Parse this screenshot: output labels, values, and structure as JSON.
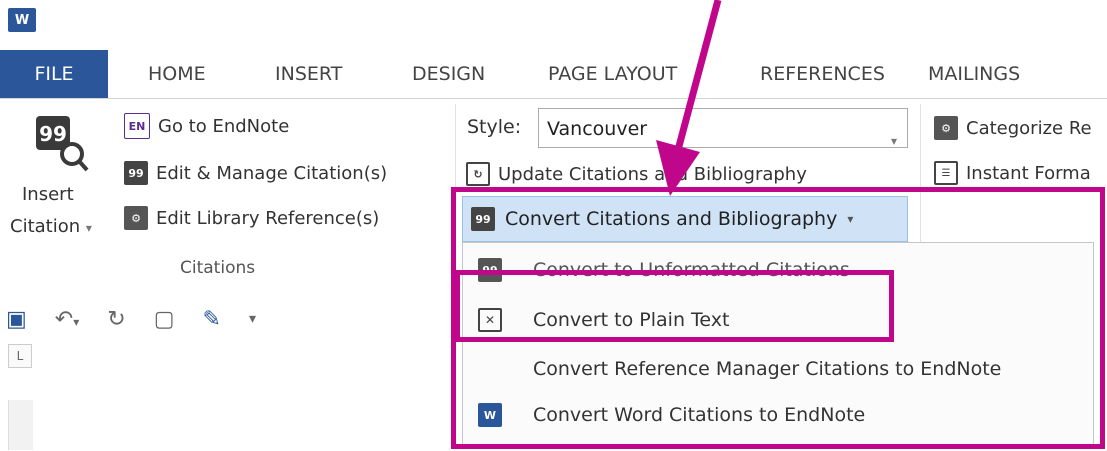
{
  "app": {
    "logo_text": "W"
  },
  "tabs": [
    "FILE",
    "HOME",
    "INSERT",
    "DESIGN",
    "PAGE LAYOUT",
    "REFERENCES",
    "MAILINGS"
  ],
  "endnote": {
    "insert_citation_line1": "Insert",
    "insert_citation_line2": "Citation",
    "go_to_endnote": "Go to EndNote",
    "go_to_endnote_badge": "EN",
    "edit_manage": "Edit & Manage Citation(s)",
    "edit_library": "Edit Library Reference(s)",
    "group_label": "Citations",
    "style_label": "Style:",
    "style_value": "Vancouver",
    "update_citations": "Update Citations and Bibliography",
    "convert_button": "Convert Citations and Bibliography",
    "categorize": "Categorize Re",
    "instant_format": "Instant Forma"
  },
  "menu": {
    "items": [
      {
        "label": "Convert to Unformatted Citations"
      },
      {
        "label": "Convert to Plain Text"
      },
      {
        "label": "Convert Reference Manager Citations to EndNote"
      },
      {
        "label": "Convert Word Citations to EndNote"
      }
    ]
  },
  "annotation": {
    "color": "#c0078c"
  },
  "colors": {
    "word_blue": "#2b579a",
    "highlight": "#cfe2f6"
  }
}
